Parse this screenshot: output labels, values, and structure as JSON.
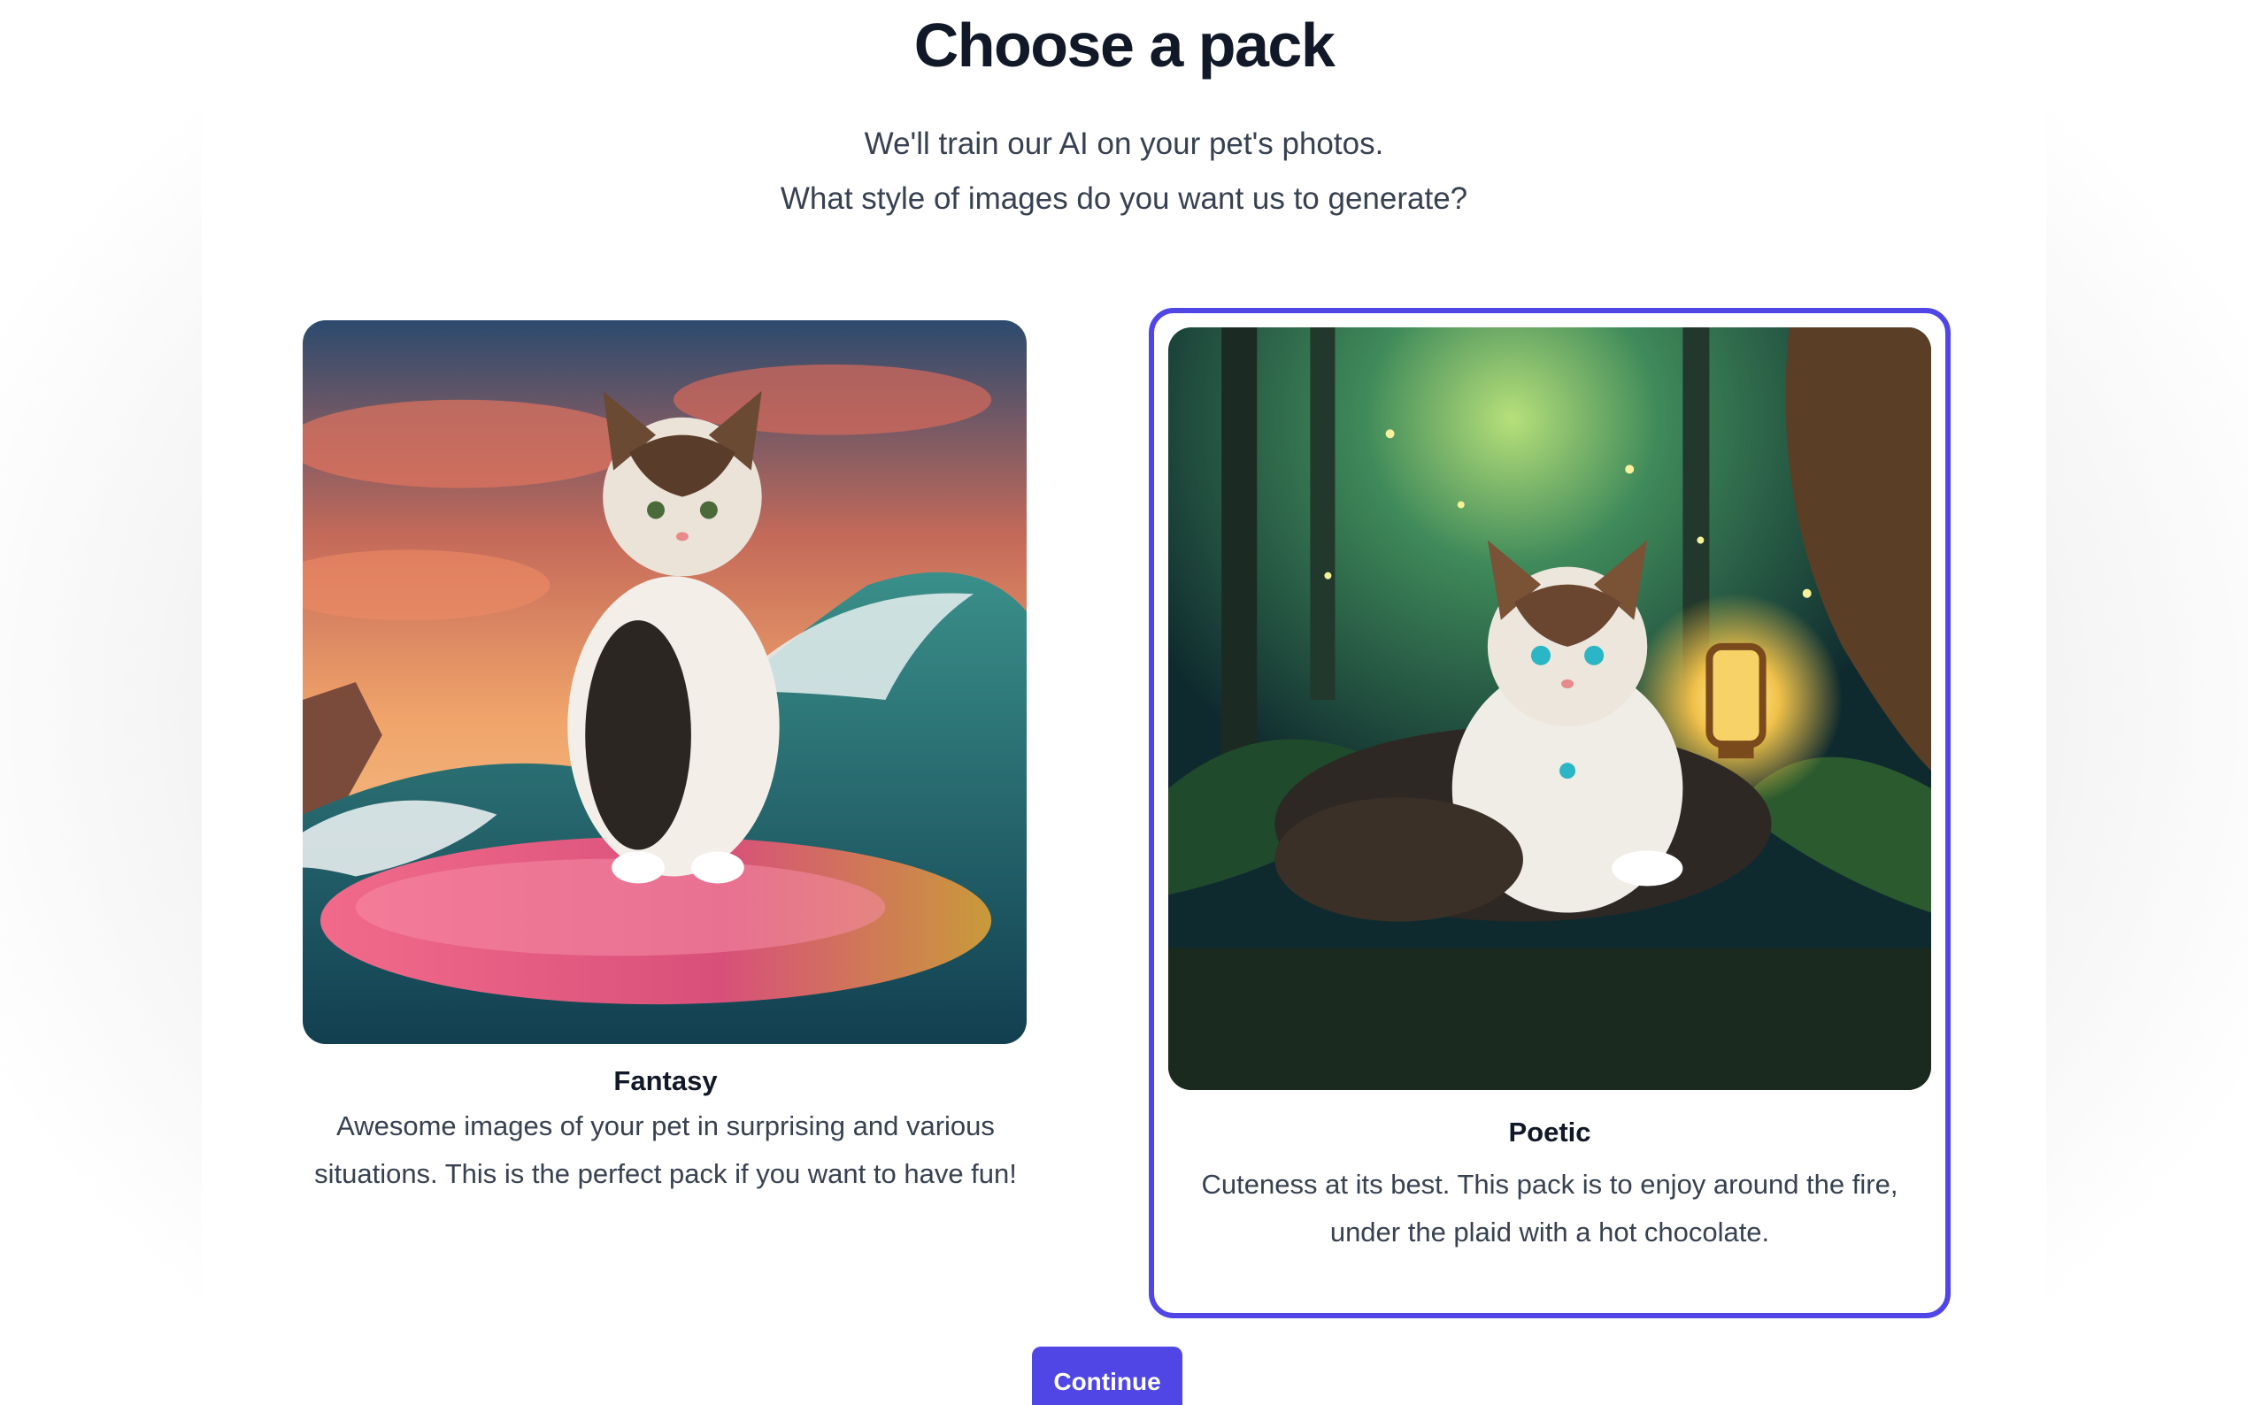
{
  "header": {
    "title": "Choose a pack",
    "subtitle_line1": "We'll train our AI on your pet's photos.",
    "subtitle_line2": "What style of images do you want us to generate?"
  },
  "packs": [
    {
      "name": "Fantasy",
      "description": "Awesome images of your pet in surprising and various situations. This is the perfect pack if you want to have fun!",
      "image": "cat-on-surfboard-wave-sunset",
      "selected": false
    },
    {
      "name": "Poetic",
      "description": "Cuteness at its best. This pack is to enjoy around the fire, under the plaid with a hot chocolate.",
      "image": "cat-in-enchanted-forest-with-lantern",
      "selected": true
    }
  ],
  "actions": {
    "continue_label": "Continue"
  },
  "colors": {
    "accent": "#4f46e5",
    "heading": "#111827",
    "body_text": "#374151"
  }
}
